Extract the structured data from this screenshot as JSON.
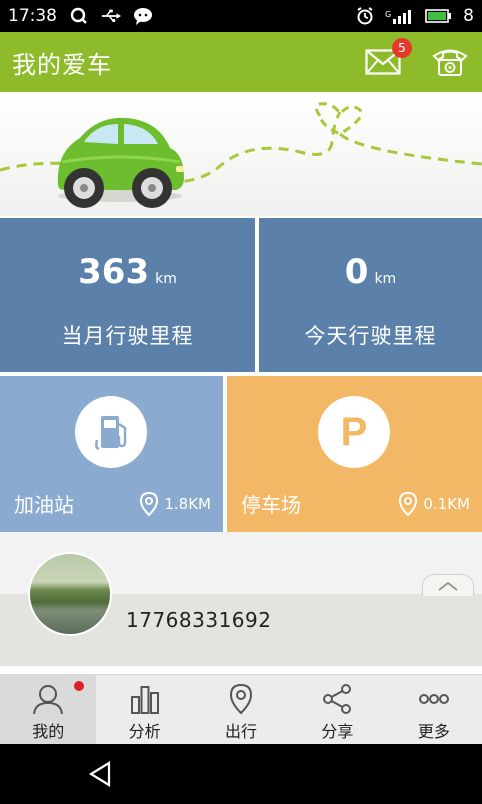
{
  "status_bar": {
    "time": "17:38",
    "battery_level": "8",
    "icons": [
      "qq-icon",
      "usb-icon",
      "wechat-icon",
      "alarm-icon",
      "signal-icon",
      "battery-icon"
    ]
  },
  "header": {
    "title": "我的爱车",
    "mail_badge": "5",
    "accent": "#8dbb2a"
  },
  "stats": {
    "month": {
      "value": "363",
      "unit": "km",
      "label": "当月行驶里程"
    },
    "today": {
      "value": "0",
      "unit": "km",
      "label": "今天行驶里程"
    }
  },
  "services": {
    "gas": {
      "name": "加油站",
      "distance": "1.8KM",
      "color": "#8aaad0"
    },
    "parking": {
      "name": "停车场",
      "distance": "0.1KM",
      "icon_letter": "P",
      "color": "#f3b865"
    }
  },
  "profile": {
    "phone": "17768331692"
  },
  "tabs": [
    {
      "label": "我的",
      "icon": "person-icon",
      "active": true
    },
    {
      "label": "分析",
      "icon": "bar-chart-icon",
      "active": false
    },
    {
      "label": "出行",
      "icon": "location-pin-icon",
      "active": false
    },
    {
      "label": "分享",
      "icon": "share-icon",
      "active": false
    },
    {
      "label": "更多",
      "icon": "more-icon",
      "active": false
    }
  ]
}
